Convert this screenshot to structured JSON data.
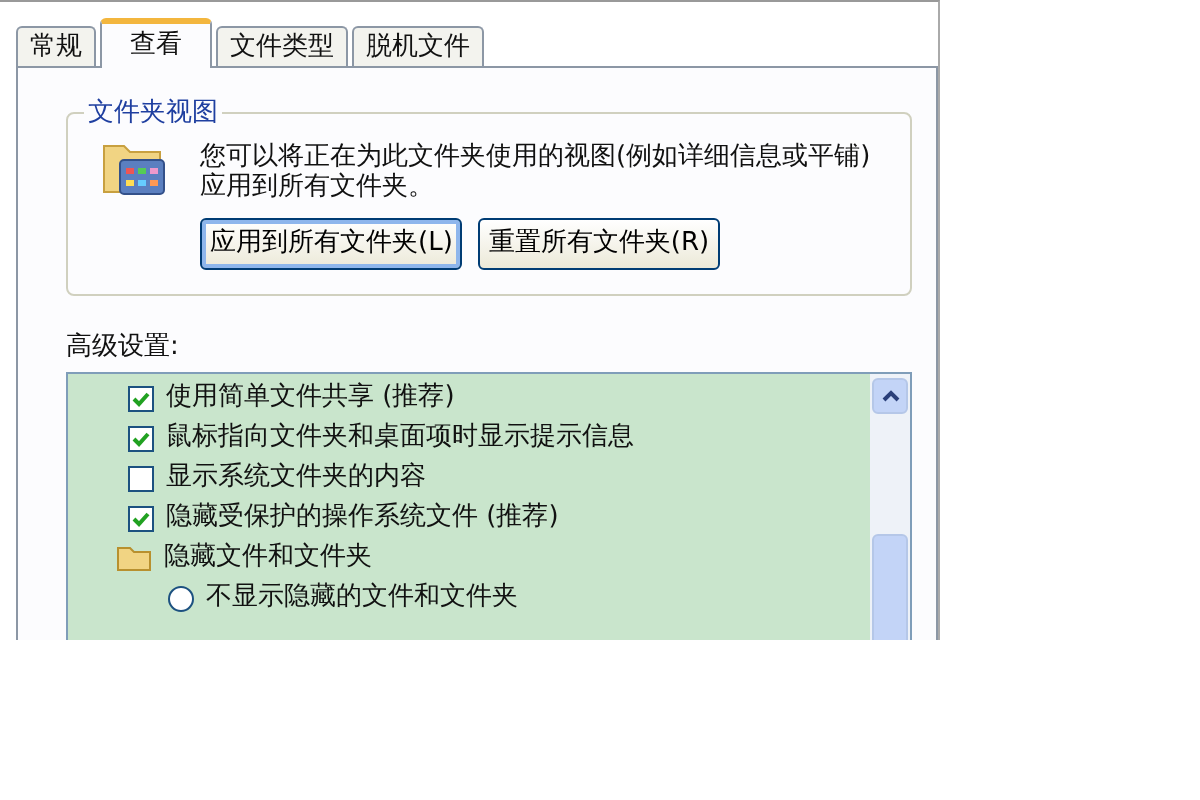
{
  "tabs": [
    {
      "label": "常规",
      "selected": false
    },
    {
      "label": "查看",
      "selected": true
    },
    {
      "label": "文件类型",
      "selected": false
    },
    {
      "label": "脱机文件",
      "selected": false
    }
  ],
  "folder_views": {
    "title": "文件夹视图",
    "description": "您可以将正在为此文件夹使用的视图(例如详细信息或平铺)应用到所有文件夹。",
    "buttons": [
      {
        "label": "应用到所有文件夹(L)",
        "focused": true
      },
      {
        "label": "重置所有文件夹(R)",
        "focused": false
      }
    ]
  },
  "advanced": {
    "label": "高级设置:",
    "items": [
      {
        "kind": "checkbox",
        "label": "使用简单文件共享 (推荐)",
        "checked": true
      },
      {
        "kind": "checkbox",
        "label": "鼠标指向文件夹和桌面项时显示提示信息",
        "checked": true
      },
      {
        "kind": "checkbox",
        "label": "显示系统文件夹的内容",
        "checked": false
      },
      {
        "kind": "checkbox",
        "label": "隐藏受保护的操作系统文件 (推荐)",
        "checked": true
      },
      {
        "kind": "folder",
        "label": "隐藏文件和文件夹"
      },
      {
        "kind": "radio",
        "label": "不显示隐藏的文件和文件夹",
        "selected": false
      }
    ]
  }
}
